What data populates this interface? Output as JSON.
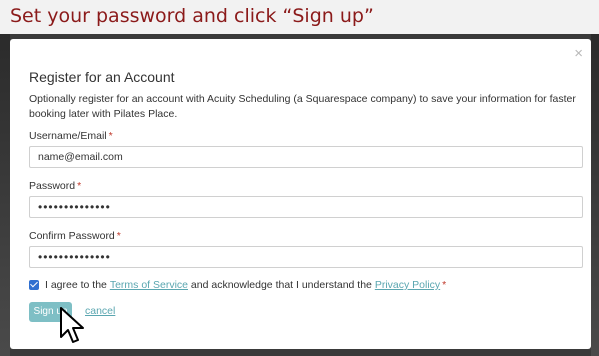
{
  "caption": "Set your password and click “Sign up”",
  "modal": {
    "title": "Register for an Account",
    "description": "Optionally register for an account with Acuity Scheduling (a Squarespace company) to save your information for faster booking later with Pilates Place.",
    "close_glyph": "×"
  },
  "form": {
    "username_label": "Username/Email",
    "username_value": "name@email.com",
    "password_label": "Password",
    "password_value": "••••••••••••••",
    "confirm_label": "Confirm Password",
    "confirm_value": "••••••••••••••",
    "required_mark": "*"
  },
  "agree": {
    "checked": true,
    "prefix": "I agree to the",
    "tos_link": "Terms of Service",
    "middle": "and acknowledge that I understand the",
    "privacy_link": "Privacy Policy",
    "required_mark": "*"
  },
  "actions": {
    "signup_label": "Sign up",
    "cancel_label": "cancel"
  },
  "colors": {
    "caption_text": "#8b1a1a",
    "accent": "#7ebfc5",
    "link": "#5aa6b0",
    "required": "#c0392b",
    "checkbox": "#2f6fd0"
  },
  "icons": {
    "close": "close-icon",
    "cursor": "arrow-cursor-icon",
    "check": "checkmark-icon"
  }
}
